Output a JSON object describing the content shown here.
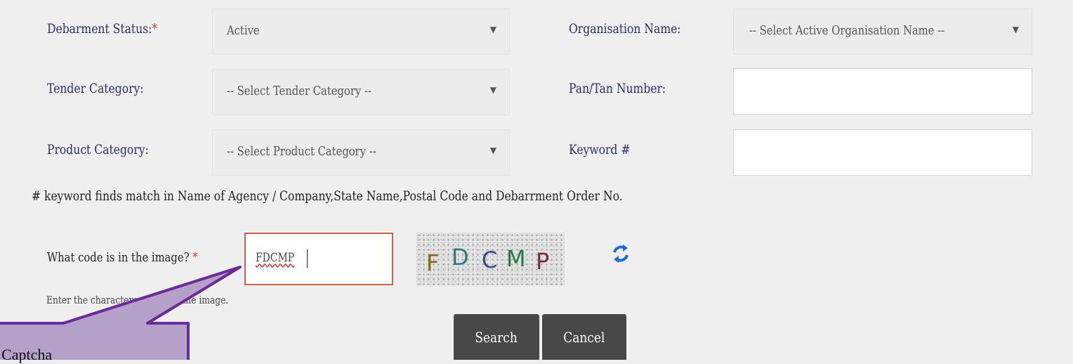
{
  "form": {
    "debarment_status_label": "Debarment Status:",
    "required_mark": "*",
    "debarment_status_value": "Active",
    "organisation_name_label": "Organisation Name:",
    "organisation_name_value": "-- Select Active Organisation Name --",
    "tender_category_label": "Tender Category:",
    "tender_category_value": "-- Select Tender Category --",
    "pan_tan_label": "Pan/Tan Number:",
    "pan_tan_value": "",
    "product_category_label": "Product Category:",
    "product_category_value": "-- Select Product Category --",
    "keyword_label": "Keyword #",
    "keyword_value": "",
    "keyword_note": "# keyword finds match in Name of Agency / Company,State Name,Postal Code and Debarrment Order No.",
    "dropdown_arrow": "▼"
  },
  "captcha": {
    "label": "What code is in the image?",
    "required_mark": "*",
    "input_value": "FDCMP",
    "image_chars": [
      "F",
      "D",
      "C",
      "M",
      "P"
    ],
    "image_colors": [
      "#8a6a1a",
      "#2e7a7a",
      "#3a4a8a",
      "#1f7a4a",
      "#7a2a3a"
    ],
    "hint": "Enter the characters shown in the image."
  },
  "buttons": {
    "search_label": "Search",
    "cancel_label": "Cancel"
  },
  "callout": {
    "text": "Fill Captcha",
    "fill_color": "#b4a0c8",
    "border_color": "#6a2a9a"
  }
}
